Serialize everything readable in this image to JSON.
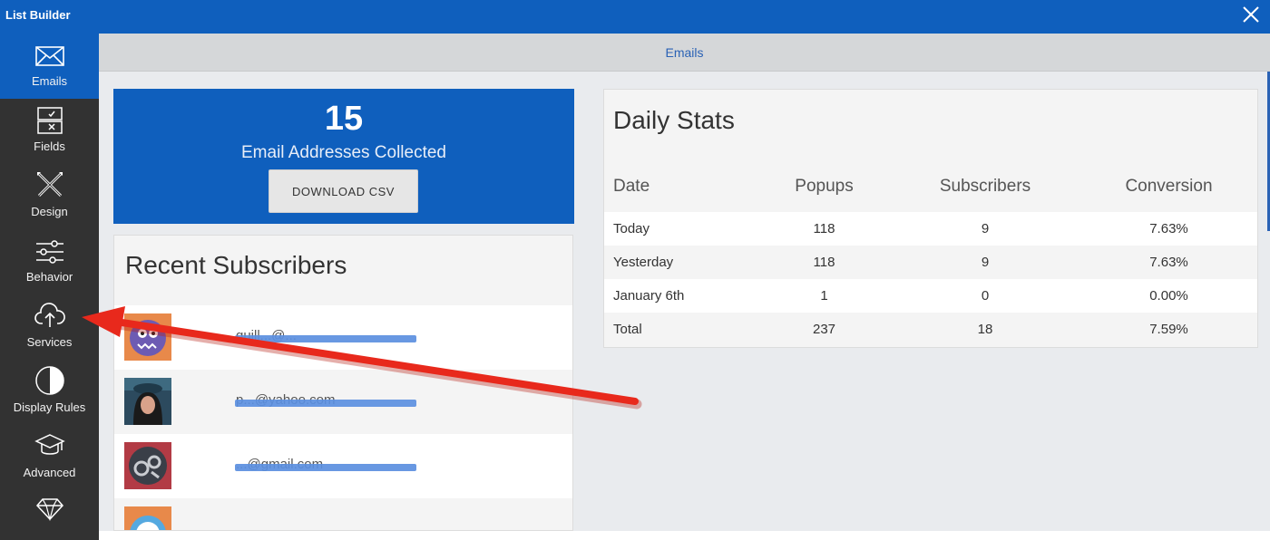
{
  "window": {
    "title": "List Builder",
    "close_icon": "close-icon"
  },
  "sidebar": {
    "items": [
      {
        "label": "Emails",
        "icon": "envelope-icon",
        "active": true
      },
      {
        "label": "Fields",
        "icon": "checkbox-form-icon",
        "active": false
      },
      {
        "label": "Design",
        "icon": "crossed-pencils-icon",
        "active": false
      },
      {
        "label": "Behavior",
        "icon": "sliders-icon",
        "active": false
      },
      {
        "label": "Services",
        "icon": "cloud-upload-icon",
        "active": false
      },
      {
        "label": "Display Rules",
        "icon": "half-circle-icon",
        "active": false
      },
      {
        "label": "Advanced",
        "icon": "graduation-cap-icon",
        "active": false
      },
      {
        "label": "",
        "icon": "diamond-icon",
        "active": false
      }
    ]
  },
  "main": {
    "header": "Emails",
    "collected": {
      "count": "15",
      "caption": "Email Addresses Collected",
      "download_label": "DOWNLOAD CSV"
    },
    "recent": {
      "heading": "Recent Subscribers",
      "subscribers": [
        {
          "email_visible": "guill...@...",
          "avatar": "monster-avatar"
        },
        {
          "email_visible": "p...@yahoo.com",
          "avatar": "photo-avatar"
        },
        {
          "email_visible": "...@gmail.com",
          "avatar": "gear-avatar"
        },
        {
          "email_visible": "",
          "avatar": "monster-avatar"
        }
      ]
    },
    "daily_stats": {
      "heading": "Daily Stats",
      "columns": [
        "Date",
        "Popups",
        "Subscribers",
        "Conversion"
      ],
      "rows": [
        [
          "Today",
          "118",
          "9",
          "7.63%"
        ],
        [
          "Yesterday",
          "118",
          "9",
          "7.63%"
        ],
        [
          "January 6th",
          "1",
          "0",
          "0.00%"
        ],
        [
          "Total",
          "237",
          "18",
          "7.59%"
        ]
      ]
    }
  },
  "colors": {
    "accent": "#0f5fbd",
    "sidebar": "#323232",
    "annotation_arrow": "#e8291c"
  }
}
